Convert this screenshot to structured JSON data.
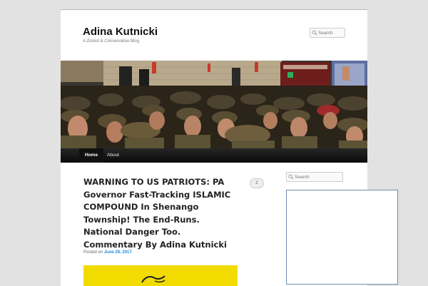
{
  "site": {
    "title": "Adina Kutnicki",
    "description": "A Zionist & Conservative Blog"
  },
  "search": {
    "placeholder": "Search"
  },
  "nav": {
    "items": [
      {
        "label": "Home",
        "active": true
      },
      {
        "label": "About",
        "active": false
      }
    ]
  },
  "post": {
    "title": "WARNING TO US PATRIOTS: PA Governor Fast-Tracking ISLAMIC COMPOUND In Shenango Township! The End-Runs. National Danger Too. Commentary By Adina Kutnicki",
    "comment_count": "2",
    "posted_on_label": "Posted on",
    "date": "June 29, 2017"
  },
  "sidebar": {
    "search_placeholder": "Search"
  },
  "colors": {
    "link": "#1b8be0",
    "post_image_bg": "#f2db00",
    "nav_bg": "#0a0a0a"
  }
}
